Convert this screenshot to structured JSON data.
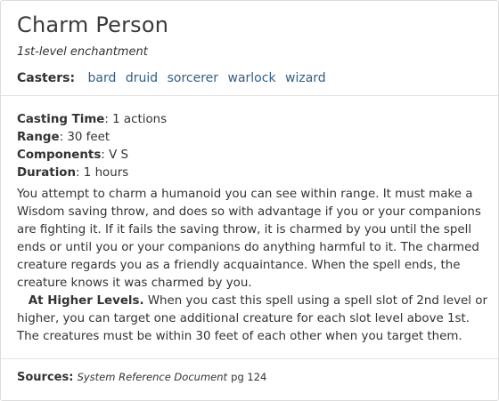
{
  "spell": {
    "name": "Charm Person",
    "level_school": "1st-level enchantment",
    "casters_label": "Casters:",
    "casters": [
      "bard",
      "druid",
      "sorcerer",
      "warlock",
      "wizard"
    ]
  },
  "stats": {
    "casting_time_label": "Casting Time",
    "casting_time": "1 actions",
    "range_label": "Range",
    "range": "30 feet",
    "components_label": "Components",
    "components": "V S",
    "duration_label": "Duration",
    "duration": "1 hours"
  },
  "description": "You attempt to charm a humanoid you can see within range. It must make a Wisdom saving throw, and does so with advantage if you or your companions are fighting it. If it fails the saving throw, it is charmed by you until the spell ends or until you or your companions do anything harmful to it. The charmed creature regards you as a friendly acquaintance. When the spell ends, the creature knows it was charmed by you.",
  "higher_levels": {
    "label": "At Higher Levels.",
    "text": "When you cast this spell using a spell slot of 2nd level or higher, you can target one additional creature for each slot level above 1st. The creatures must be within 30 feet of each other when you target them."
  },
  "sources": {
    "label": "Sources:",
    "document": "System Reference Document",
    "page": "pg 124"
  }
}
